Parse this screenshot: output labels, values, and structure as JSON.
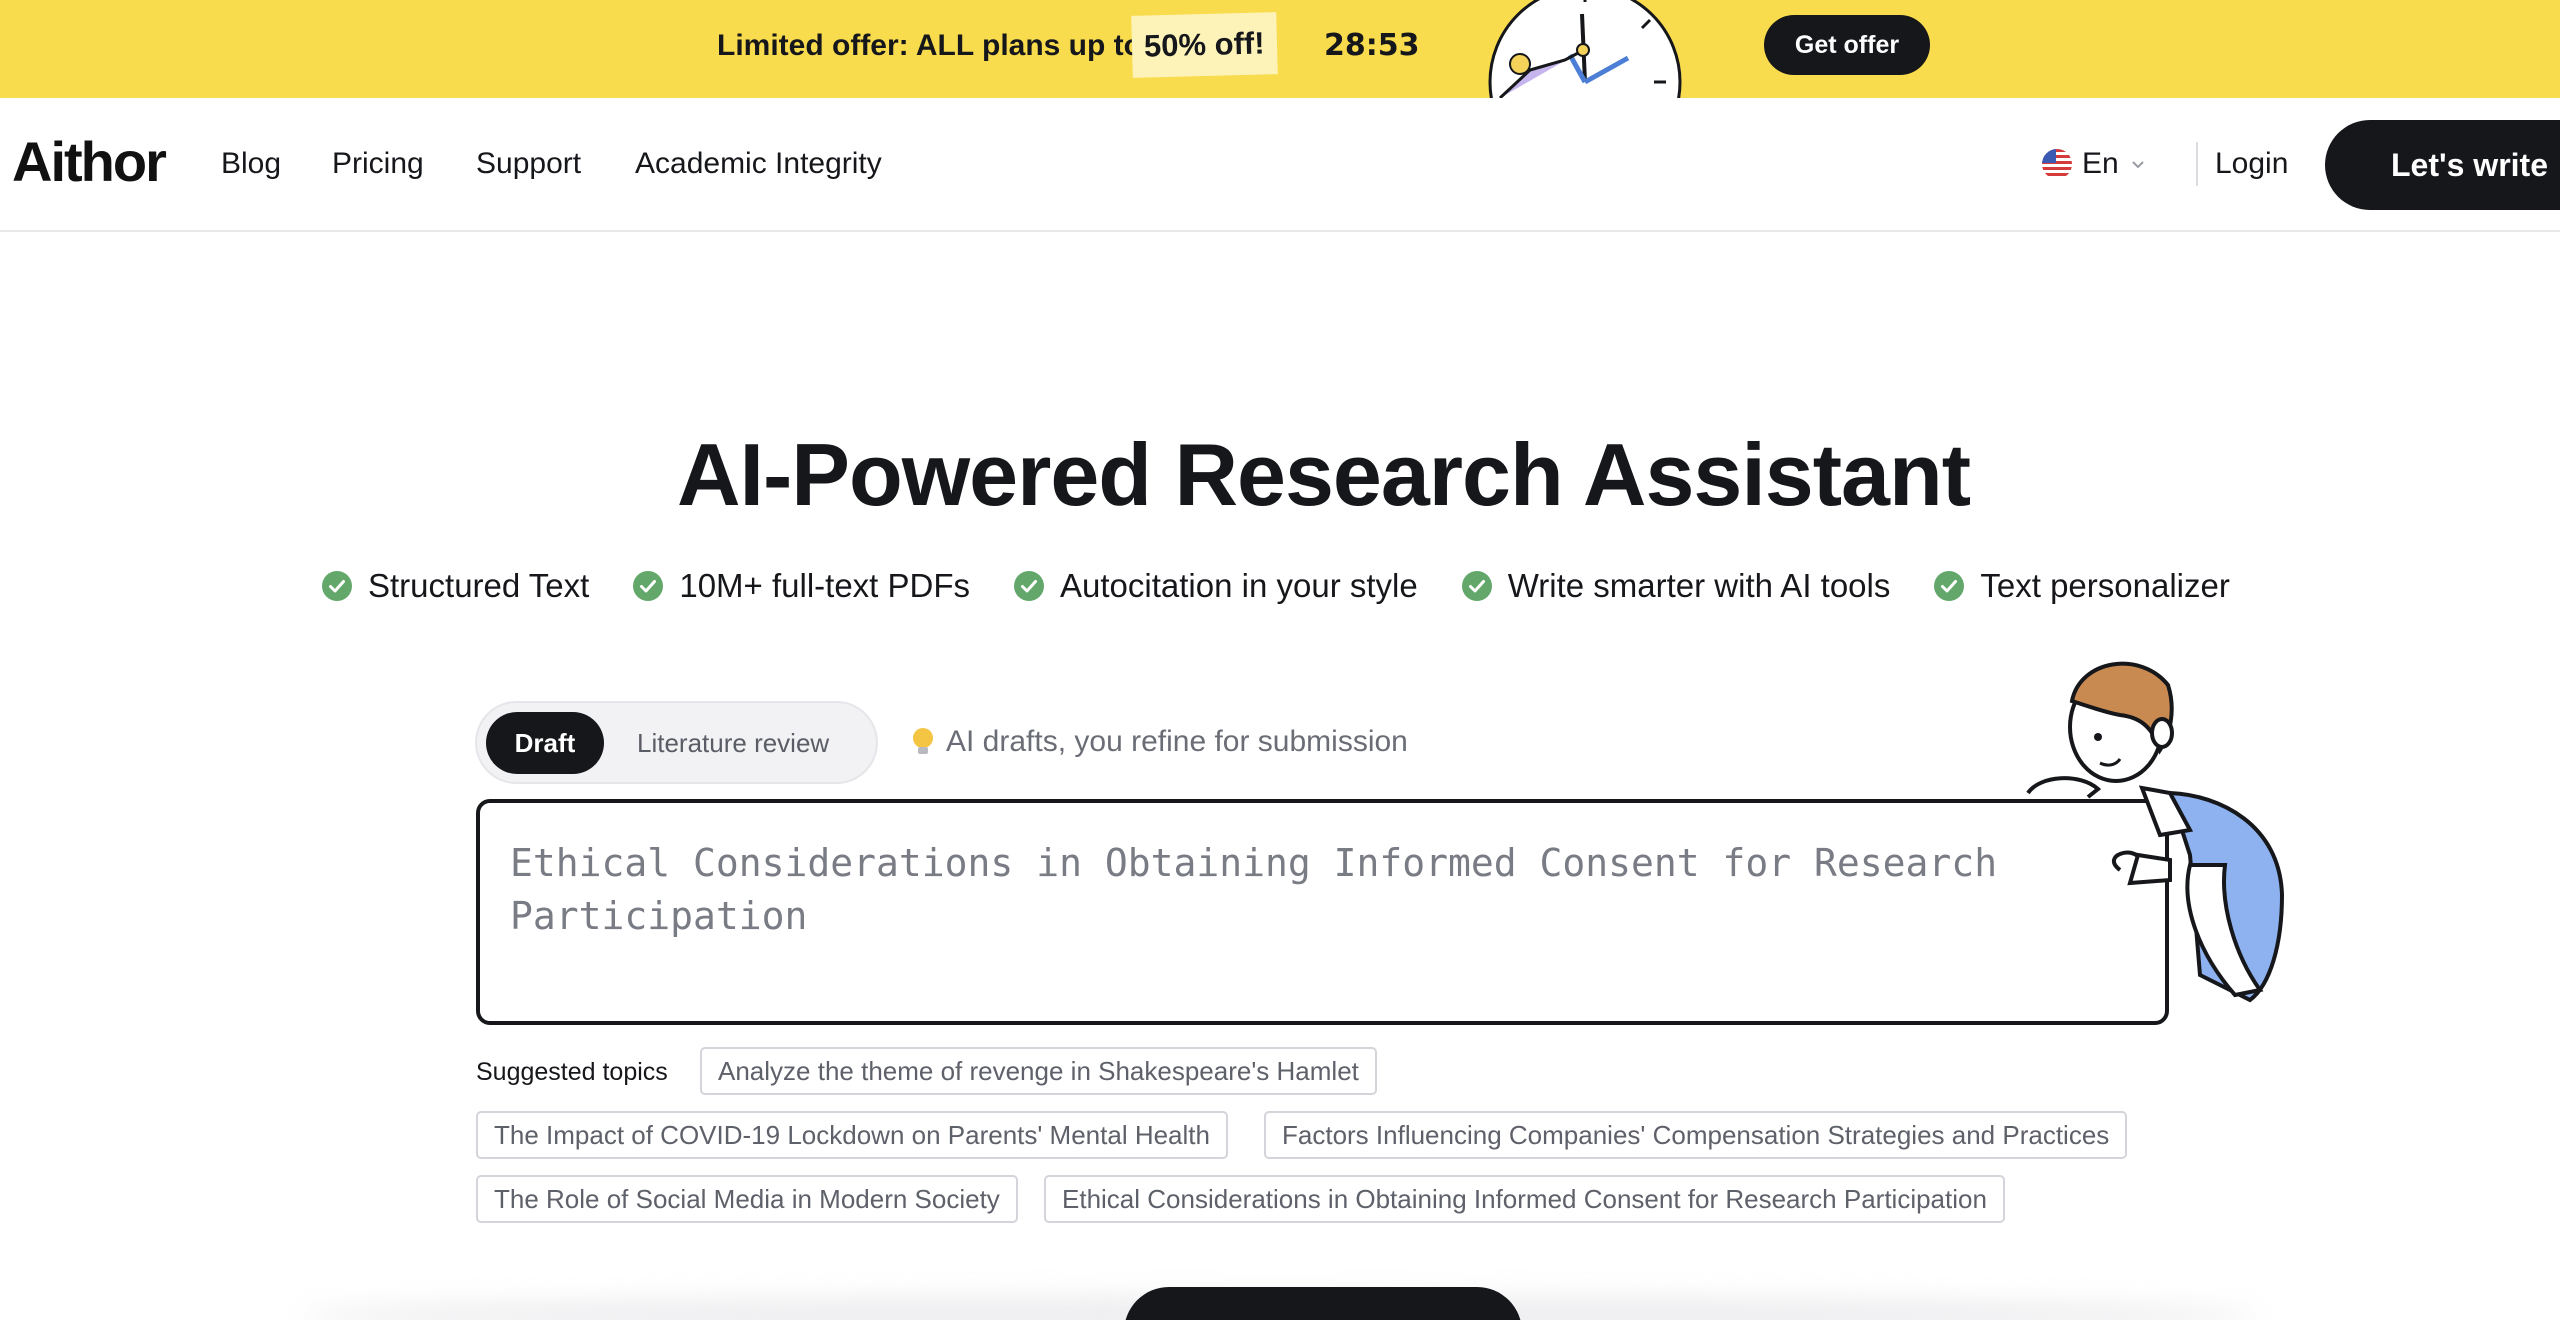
{
  "promo": {
    "text": "Limited offer: ALL plans up to",
    "discount": "50% off!",
    "timer": "28:53",
    "button_label": "Get offer"
  },
  "nav": {
    "logo": "Aithor",
    "links": [
      "Blog",
      "Pricing",
      "Support",
      "Academic Integrity"
    ],
    "language": "En",
    "login_label": "Login",
    "cta_label": "Let's write"
  },
  "hero": {
    "title": "AI-Powered Research Assistant",
    "features": [
      "Structured Text",
      "10M+ full-text PDFs",
      "Autocitation in your style",
      "Write smarter with AI tools",
      "Text personalizer"
    ]
  },
  "mode": {
    "active": "Draft",
    "inactive": "Literature review",
    "hint": "AI drafts, you refine for submission"
  },
  "topic_input": {
    "placeholder": "Ethical Considerations in Obtaining Informed Consent for Research Participation"
  },
  "suggestions": {
    "label": "Suggested topics",
    "topics": [
      "Analyze the theme of revenge in Shakespeare's Hamlet",
      "The Impact of COVID-19 Lockdown on Parents' Mental Health",
      "Factors Influencing Companies' Compensation Strategies and Practices",
      "The Role of Social Media in Modern Society",
      "Ethical Considerations in Obtaining Informed Consent for Research Participation"
    ]
  },
  "colors": {
    "banner": "#f8dc4e",
    "primary": "#16171b",
    "check": "#63a86a"
  }
}
